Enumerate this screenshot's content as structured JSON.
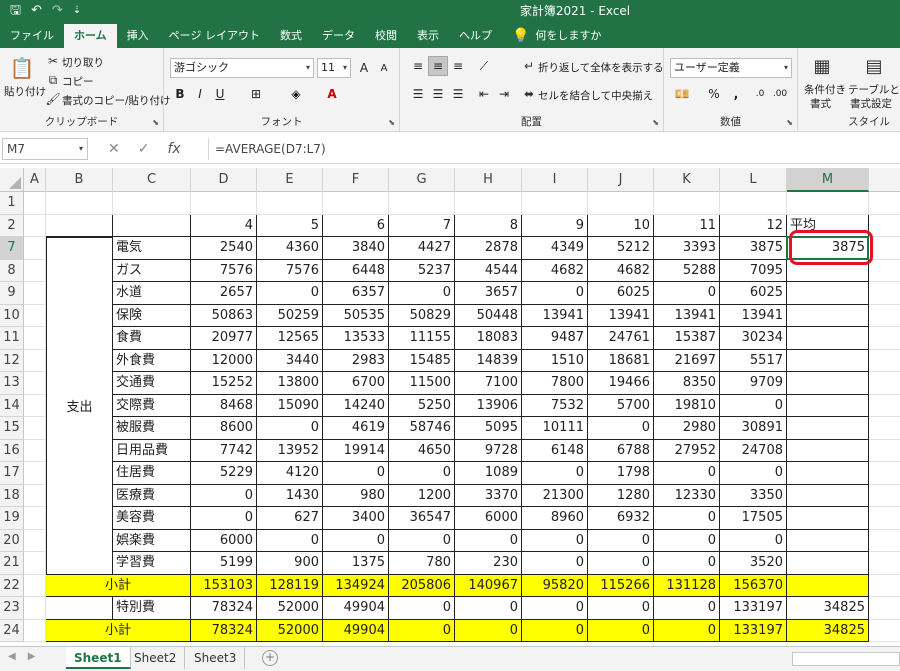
{
  "window": {
    "title": "家計簿2021 - Excel"
  },
  "quick_access": {
    "save": "🖫",
    "undo": "↶",
    "redo": "↷",
    "more": "⇣"
  },
  "tabs": [
    "ファイル",
    "ホーム",
    "挿入",
    "ページ レイアウト",
    "数式",
    "データ",
    "校閲",
    "表示",
    "ヘルプ"
  ],
  "tell_me": "何をしますか",
  "clipboard": {
    "paste": "貼り付け",
    "cut": "切り取り",
    "copy": "コピー",
    "format_painter": "書式のコピー/貼り付け",
    "label": "クリップボード"
  },
  "font": {
    "name": "游ゴシック",
    "size": "11",
    "grow": "A",
    "shrink": "A",
    "bold": "B",
    "italic": "I",
    "underline": "U",
    "label": "フォント"
  },
  "alignment": {
    "wrap": "折り返して全体を表示する",
    "merge": "セルを結合して中央揃え",
    "label": "配置"
  },
  "number": {
    "format": "ユーザー定義",
    "percent": "%",
    "comma": ",",
    "label": "数値"
  },
  "styles": {
    "conditional": "条件付き",
    "conditional2": "書式",
    "table": "テーブルとして",
    "table2": "書式設定",
    "label": "スタイル"
  },
  "formula_bar": {
    "name_box": "M7",
    "cancel": "✕",
    "enter": "✓",
    "fx": "fx",
    "formula": "=AVERAGE(D7:L7)"
  },
  "columns": [
    "A",
    "B",
    "C",
    "D",
    "E",
    "F",
    "G",
    "H",
    "I",
    "J",
    "K",
    "L",
    "M"
  ],
  "row_numbers": [
    "1",
    "2",
    "7",
    "8",
    "9",
    "10",
    "11",
    "12",
    "13",
    "14",
    "15",
    "16",
    "17",
    "18",
    "19",
    "20",
    "21",
    "22",
    "23",
    "24"
  ],
  "sheet": {
    "header_row": [
      "4",
      "5",
      "6",
      "7",
      "8",
      "9",
      "10",
      "11",
      "12",
      "平均"
    ],
    "expense_label": "支出",
    "rows": [
      {
        "label": "電気",
        "values": [
          "2540",
          "4360",
          "3840",
          "4427",
          "2878",
          "4349",
          "5212",
          "3393",
          "3875",
          "3875"
        ]
      },
      {
        "label": "ガス",
        "values": [
          "7576",
          "7576",
          "6448",
          "5237",
          "4544",
          "4682",
          "4682",
          "5288",
          "7095",
          ""
        ]
      },
      {
        "label": "水道",
        "values": [
          "2657",
          "0",
          "6357",
          "0",
          "3657",
          "0",
          "6025",
          "0",
          "6025",
          ""
        ]
      },
      {
        "label": "保険",
        "values": [
          "50863",
          "50259",
          "50535",
          "50829",
          "50448",
          "13941",
          "13941",
          "13941",
          "13941",
          ""
        ]
      },
      {
        "label": "食費",
        "values": [
          "20977",
          "12565",
          "13533",
          "11155",
          "18083",
          "9487",
          "24761",
          "15387",
          "30234",
          ""
        ]
      },
      {
        "label": "外食費",
        "values": [
          "12000",
          "3440",
          "2983",
          "15485",
          "14839",
          "1510",
          "18681",
          "21697",
          "5517",
          ""
        ]
      },
      {
        "label": "交通費",
        "values": [
          "15252",
          "13800",
          "6700",
          "11500",
          "7100",
          "7800",
          "19466",
          "8350",
          "9709",
          ""
        ]
      },
      {
        "label": "交際費",
        "values": [
          "8468",
          "15090",
          "14240",
          "5250",
          "13906",
          "7532",
          "5700",
          "19810",
          "0",
          ""
        ]
      },
      {
        "label": "被服費",
        "values": [
          "8600",
          "0",
          "4619",
          "58746",
          "5095",
          "10111",
          "0",
          "2980",
          "30891",
          ""
        ]
      },
      {
        "label": "日用品費",
        "values": [
          "7742",
          "13952",
          "19914",
          "4650",
          "9728",
          "6148",
          "6788",
          "27952",
          "24708",
          ""
        ]
      },
      {
        "label": "住居費",
        "values": [
          "5229",
          "4120",
          "0",
          "0",
          "1089",
          "0",
          "1798",
          "0",
          "0",
          ""
        ]
      },
      {
        "label": "医療費",
        "values": [
          "0",
          "1430",
          "980",
          "1200",
          "3370",
          "21300",
          "1280",
          "12330",
          "3350",
          ""
        ]
      },
      {
        "label": "美容費",
        "values": [
          "0",
          "627",
          "3400",
          "36547",
          "6000",
          "8960",
          "6932",
          "0",
          "17505",
          ""
        ]
      },
      {
        "label": "娯楽費",
        "values": [
          "6000",
          "0",
          "0",
          "0",
          "0",
          "0",
          "0",
          "0",
          "0",
          ""
        ]
      },
      {
        "label": "学習費",
        "values": [
          "5199",
          "900",
          "1375",
          "780",
          "230",
          "0",
          "0",
          "0",
          "3520",
          ""
        ]
      }
    ],
    "subtotal1": {
      "label": "小計",
      "values": [
        "153103",
        "128119",
        "134924",
        "205806",
        "140967",
        "95820",
        "115266",
        "131128",
        "156370",
        ""
      ]
    },
    "special": {
      "label": "特別費",
      "values": [
        "78324",
        "52000",
        "49904",
        "0",
        "0",
        "0",
        "0",
        "0",
        "133197",
        "34825"
      ]
    },
    "subtotal2": {
      "label": "小計",
      "values": [
        "78324",
        "52000",
        "49904",
        "0",
        "0",
        "0",
        "0",
        "0",
        "133197",
        "34825"
      ]
    }
  },
  "sheet_tabs": [
    "Sheet1",
    "Sheet2",
    "Sheet3"
  ],
  "colors": {
    "excel_green": "#217346",
    "highlight": "#ffff00",
    "annotation": "#e81123"
  }
}
